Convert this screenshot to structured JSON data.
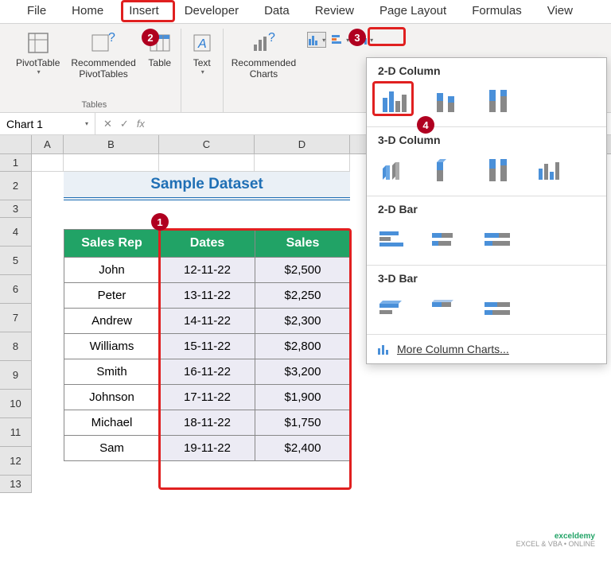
{
  "tabs": [
    "File",
    "Home",
    "Insert",
    "Developer",
    "Data",
    "Review",
    "Page Layout",
    "Formulas",
    "View"
  ],
  "ribbon": {
    "pivot": "PivotTable",
    "recpivot": "Recommended\nPivotTables",
    "table": "Table",
    "text": "Text",
    "reccharts": "Recommended\nCharts",
    "group_tables": "Tables"
  },
  "namebox": "Chart 1",
  "fx_label": "fx",
  "cols": [
    "A",
    "B",
    "C",
    "D"
  ],
  "title": "Sample Dataset",
  "headers": {
    "rep": "Sales Rep",
    "dates": "Dates",
    "sales": "Sales"
  },
  "rows": [
    {
      "rep": "John",
      "date": "12-11-22",
      "sales": "$2,500"
    },
    {
      "rep": "Peter",
      "date": "13-11-22",
      "sales": "$2,250"
    },
    {
      "rep": "Andrew",
      "date": "14-11-22",
      "sales": "$2,300"
    },
    {
      "rep": "Williams",
      "date": "15-11-22",
      "sales": "$2,800"
    },
    {
      "rep": "Smith",
      "date": "16-11-22",
      "sales": "$3,200"
    },
    {
      "rep": "Johnson",
      "date": "17-11-22",
      "sales": "$1,900"
    },
    {
      "rep": "Michael",
      "date": "18-11-22",
      "sales": "$1,750"
    },
    {
      "rep": "Sam",
      "date": "19-11-22",
      "sales": "$2,400"
    }
  ],
  "dropdown": {
    "s1": "2-D Column",
    "s2": "3-D Column",
    "s3": "2-D Bar",
    "s4": "3-D Bar",
    "more": "More Column Charts..."
  },
  "badges": {
    "b1": "1",
    "b2": "2",
    "b3": "3",
    "b4": "4"
  },
  "watermark": {
    "brand": "exceldemy",
    "sub": "EXCEL & VBA • ONLINE"
  }
}
